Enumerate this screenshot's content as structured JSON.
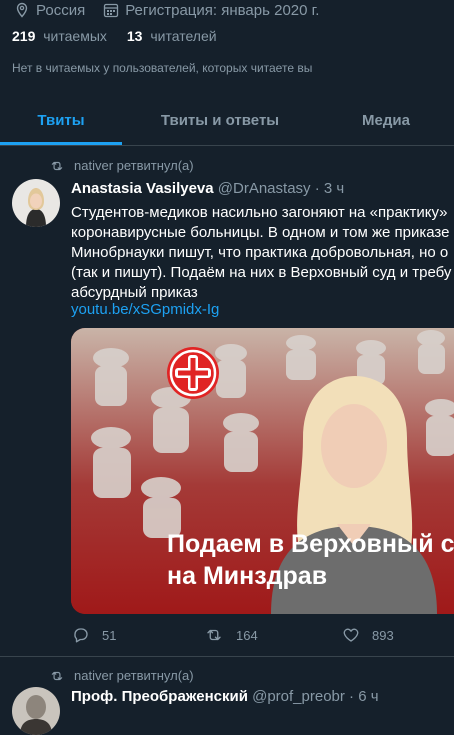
{
  "profile": {
    "location": "Россия",
    "joined": "Регистрация: январь 2020 г.",
    "following_count": "219",
    "following_label": "читаемых",
    "followers_count": "13",
    "followers_label": "читателей",
    "mutual_note": "Нет в читаемых у пользователей, которых читаете вы"
  },
  "tabs": [
    {
      "label": "Твиты",
      "active": true
    },
    {
      "label": "Твиты и ответы",
      "active": false
    },
    {
      "label": "Медиа",
      "active": false
    }
  ],
  "tweets": [
    {
      "retweeted_by": "nativer ретвитнул(а)",
      "name": "Anastasia Vasilyeva",
      "handle": "@DrAnastasy",
      "time": "· 3 ч",
      "text_lines": [
        "Студентов-медиков насильно загоняют на «практику»",
        "коронавирусные больницы. В одном и том же приказе",
        "Минобрнауки пишут, что практика добровольная, но о",
        "(так и пишут). Подаём на них в Верховный суд и требу",
        "абсурдный приказ"
      ],
      "link": "youtu.be/xSGpmidx-Ig",
      "card_caption_lines": [
        "Подаем в Верховный су",
        "на Минздрав"
      ],
      "replies": "51",
      "retweets": "164",
      "likes": "893"
    },
    {
      "retweeted_by": "nativer ретвитнул(а)",
      "name": "Проф. Преображенский",
      "handle": "@prof_preobr",
      "time": "· 6 ч"
    }
  ],
  "colors": {
    "background": "#15202b",
    "accent": "#1da1f2",
    "muted": "#8899a6",
    "divider": "#38444d"
  },
  "icons": {
    "location": "location-pin-icon",
    "calendar": "calendar-icon",
    "retweet": "retweet-icon",
    "reply": "reply-icon",
    "like": "heart-icon",
    "brand": "red-cross-logo-icon"
  }
}
